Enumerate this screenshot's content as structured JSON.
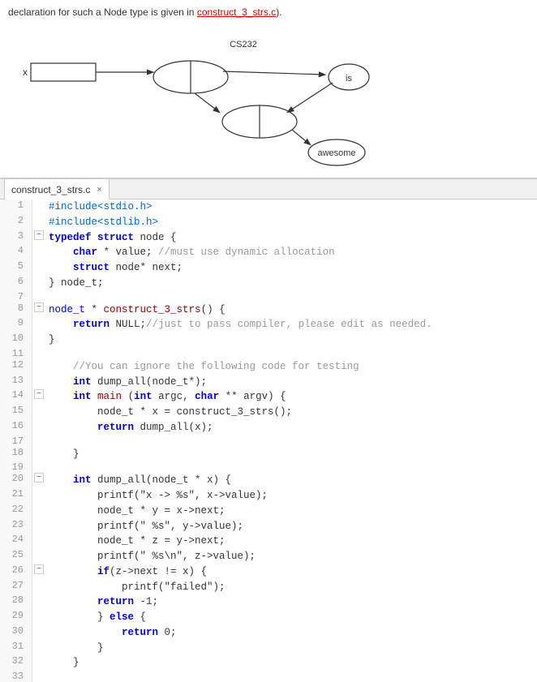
{
  "diagram": {
    "intro_text": "declaration for such a Node type is given in ",
    "intro_link": "construct_3_strs.c",
    "intro_suffix": ")."
  },
  "tab": {
    "filename": "construct_3_strs.c",
    "close_label": "×"
  },
  "code": {
    "lines": [
      {
        "num": 1,
        "gutter": "",
        "tokens": [
          {
            "t": "preproc",
            "v": "#include<stdio.h>"
          }
        ]
      },
      {
        "num": 2,
        "gutter": "",
        "tokens": [
          {
            "t": "preproc",
            "v": "#include<stdlib.h>"
          }
        ]
      },
      {
        "num": 3,
        "gutter": "−",
        "tokens": [
          {
            "t": "kw",
            "v": "typedef"
          },
          {
            "t": "plain",
            "v": " "
          },
          {
            "t": "kw",
            "v": "struct"
          },
          {
            "t": "plain",
            "v": " node {"
          }
        ]
      },
      {
        "num": 4,
        "gutter": "",
        "tokens": [
          {
            "t": "plain",
            "v": "        "
          },
          {
            "t": "kw",
            "v": "char"
          },
          {
            "t": "plain",
            "v": " * value; "
          },
          {
            "t": "comment",
            "v": "//must use dynamic allocation"
          }
        ]
      },
      {
        "num": 5,
        "gutter": "",
        "tokens": [
          {
            "t": "plain",
            "v": "        "
          },
          {
            "t": "kw",
            "v": "struct"
          },
          {
            "t": "plain",
            "v": " node* next;"
          }
        ]
      },
      {
        "num": 6,
        "gutter": "",
        "tokens": [
          {
            "t": "plain",
            "v": "} node_t;"
          }
        ]
      },
      {
        "num": 7,
        "gutter": "",
        "tokens": []
      },
      {
        "num": 8,
        "gutter": "−",
        "tokens": [
          {
            "t": "type",
            "v": "node_t"
          },
          {
            "t": "plain",
            "v": " * "
          },
          {
            "t": "fn",
            "v": "construct_3_strs"
          },
          {
            "t": "plain",
            "v": "() {"
          }
        ]
      },
      {
        "num": 9,
        "gutter": "",
        "tokens": [
          {
            "t": "plain",
            "v": "        "
          },
          {
            "t": "kw",
            "v": "return"
          },
          {
            "t": "plain",
            "v": " NULL;"
          },
          {
            "t": "comment",
            "v": "//just to pass compiler, please edit as needed."
          }
        ]
      },
      {
        "num": 10,
        "gutter": "",
        "tokens": [
          {
            "t": "plain",
            "v": "}"
          }
        ]
      },
      {
        "num": 11,
        "gutter": "",
        "tokens": []
      },
      {
        "num": 12,
        "gutter": "",
        "tokens": [
          {
            "t": "plain",
            "v": "    "
          },
          {
            "t": "comment",
            "v": "//You can ignore the following code for testing"
          }
        ]
      },
      {
        "num": 13,
        "gutter": "",
        "tokens": [
          {
            "t": "plain",
            "v": "    "
          },
          {
            "t": "kw",
            "v": "int"
          },
          {
            "t": "plain",
            "v": " dump_all(node_t*);"
          }
        ]
      },
      {
        "num": 14,
        "gutter": "−",
        "tokens": [
          {
            "t": "plain",
            "v": "    "
          },
          {
            "t": "kw",
            "v": "int"
          },
          {
            "t": "plain",
            "v": " "
          },
          {
            "t": "fn",
            "v": "main"
          },
          {
            "t": "plain",
            "v": " ("
          },
          {
            "t": "kw",
            "v": "int"
          },
          {
            "t": "plain",
            "v": " argc, "
          },
          {
            "t": "kw",
            "v": "char"
          },
          {
            "t": "plain",
            "v": " ** argv) {"
          }
        ]
      },
      {
        "num": 15,
        "gutter": "",
        "tokens": [
          {
            "t": "plain",
            "v": "        node_t * x = construct_3_strs();"
          }
        ]
      },
      {
        "num": 16,
        "gutter": "",
        "tokens": [
          {
            "t": "plain",
            "v": "        "
          },
          {
            "t": "kw",
            "v": "return"
          },
          {
            "t": "plain",
            "v": " dump_all(x);"
          }
        ]
      },
      {
        "num": 17,
        "gutter": "",
        "tokens": []
      },
      {
        "num": 18,
        "gutter": "",
        "tokens": [
          {
            "t": "plain",
            "v": "    }"
          }
        ]
      },
      {
        "num": 19,
        "gutter": "",
        "tokens": []
      },
      {
        "num": 20,
        "gutter": "−",
        "tokens": [
          {
            "t": "plain",
            "v": "    "
          },
          {
            "t": "kw",
            "v": "int"
          },
          {
            "t": "plain",
            "v": " dump_all(node_t * x) {"
          }
        ]
      },
      {
        "num": 21,
        "gutter": "",
        "tokens": [
          {
            "t": "plain",
            "v": "        printf(\""
          },
          {
            "t": "plain",
            "v": "x -> %s\", x->value);"
          }
        ]
      },
      {
        "num": 22,
        "gutter": "",
        "tokens": [
          {
            "t": "plain",
            "v": "        node_t * y = x->next;"
          }
        ]
      },
      {
        "num": 23,
        "gutter": "",
        "tokens": [
          {
            "t": "plain",
            "v": "        printf(\" %s\", y->value);"
          }
        ]
      },
      {
        "num": 24,
        "gutter": "",
        "tokens": [
          {
            "t": "plain",
            "v": "        node_t * z = y->next;"
          }
        ]
      },
      {
        "num": 25,
        "gutter": "",
        "tokens": [
          {
            "t": "plain",
            "v": "        printf(\" %s\\n\", z->value);"
          }
        ]
      },
      {
        "num": 26,
        "gutter": "−",
        "tokens": [
          {
            "t": "plain",
            "v": "        "
          },
          {
            "t": "kw",
            "v": "if"
          },
          {
            "t": "plain",
            "v": "(z->next != x) {"
          }
        ]
      },
      {
        "num": 27,
        "gutter": "",
        "tokens": [
          {
            "t": "plain",
            "v": "            printf(\"failed\");"
          }
        ]
      },
      {
        "num": 28,
        "gutter": "",
        "tokens": [
          {
            "t": "plain",
            "v": "        "
          },
          {
            "t": "kw",
            "v": "return"
          },
          {
            "t": "plain",
            "v": " -1;"
          }
        ]
      },
      {
        "num": 29,
        "gutter": "",
        "tokens": [
          {
            "t": "plain",
            "v": "        } "
          },
          {
            "t": "kw",
            "v": "else"
          },
          {
            "t": "plain",
            "v": " {"
          }
        ]
      },
      {
        "num": 30,
        "gutter": "",
        "tokens": [
          {
            "t": "plain",
            "v": "            "
          },
          {
            "t": "kw",
            "v": "return"
          },
          {
            "t": "plain",
            "v": " 0;"
          }
        ]
      },
      {
        "num": 31,
        "gutter": "",
        "tokens": [
          {
            "t": "plain",
            "v": "        }"
          }
        ]
      },
      {
        "num": 32,
        "gutter": "",
        "tokens": [
          {
            "t": "plain",
            "v": "    }"
          }
        ]
      },
      {
        "num": 33,
        "gutter": "",
        "tokens": []
      }
    ]
  }
}
